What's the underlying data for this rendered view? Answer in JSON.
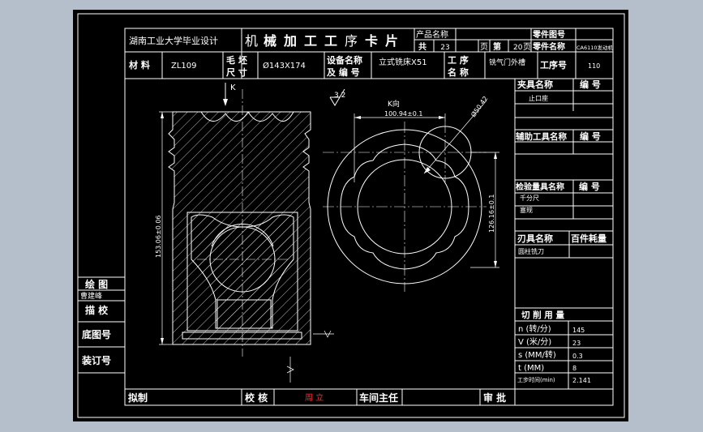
{
  "header": {
    "school": "湖南工业大学毕业设计",
    "card_title": [
      "机",
      "械",
      "加",
      "工",
      "工",
      "序",
      "卡",
      "片"
    ],
    "product_name_label": "产品名称",
    "part_drawing_label": "零件图号",
    "total_label": "共",
    "total_pages": "23",
    "page_unit": "页",
    "page_label": "第",
    "page_no": "20",
    "part_name_label": "零件名称",
    "part_name_value": "CA6110发动机",
    "material_label": "材 料",
    "material_value": "ZL109",
    "blank_size_label": [
      "毛 坯",
      "尺 寸"
    ],
    "blank_size_value": "Ø143X174",
    "equipment_label": [
      "设备名称",
      "及 编 号"
    ],
    "equipment_value": "立式铣床X51",
    "process_name_label": [
      "工 序",
      "名 称"
    ],
    "process_name_value": "铣气门外槽",
    "process_no_label": "工序号",
    "process_no_value": "110"
  },
  "sidebar": {
    "draw_label": "绘 图",
    "draw_name": "曹建峰",
    "trace_label": "描 校",
    "base_drawing_label": "底图号",
    "binding_label": "装订号"
  },
  "right_panel": {
    "fixture_header": [
      "夹具名称",
      "编 号"
    ],
    "fixture_items": [
      "止口座"
    ],
    "aux_tool_header": [
      "辅助工具名称",
      "编 号"
    ],
    "gauge_header": [
      "检验量具名称",
      "编 号"
    ],
    "gauge_items": [
      "千分尺",
      "塞规"
    ],
    "cutter_header": [
      "刃具名称",
      "百件耗量"
    ],
    "cutter_items": [
      "圆柱铣刀"
    ],
    "cutting_header": "切 削 用 量",
    "cutting_params": [
      {
        "label": "n (转/分)",
        "value": "145"
      },
      {
        "label": "V (米/分)",
        "value": "23"
      },
      {
        "label": "s (MM/转)",
        "value": "0.3"
      },
      {
        "label": "t (MM)",
        "value": "8"
      },
      {
        "label": "工步时间(min)",
        "value": "2.141"
      }
    ]
  },
  "footer": {
    "drafter_label": "拟制",
    "checker_label": "校 核",
    "checker_name": "周 立",
    "workshop_label": "车间主任",
    "approval_label": "审 批"
  },
  "drawing": {
    "view_arrow_label": "K",
    "view_title": "K向",
    "roughness": "3.2",
    "dim_height": "153.06±0.06",
    "dim_width": "100.94±0.1",
    "dim_vertical": "126.16±0.1",
    "dim_circle": "Ø50.42"
  },
  "colors": {
    "background": "#000000",
    "lines": "#ffffff",
    "signature": "#ff2a2a",
    "frame": "#b5bfcc"
  }
}
